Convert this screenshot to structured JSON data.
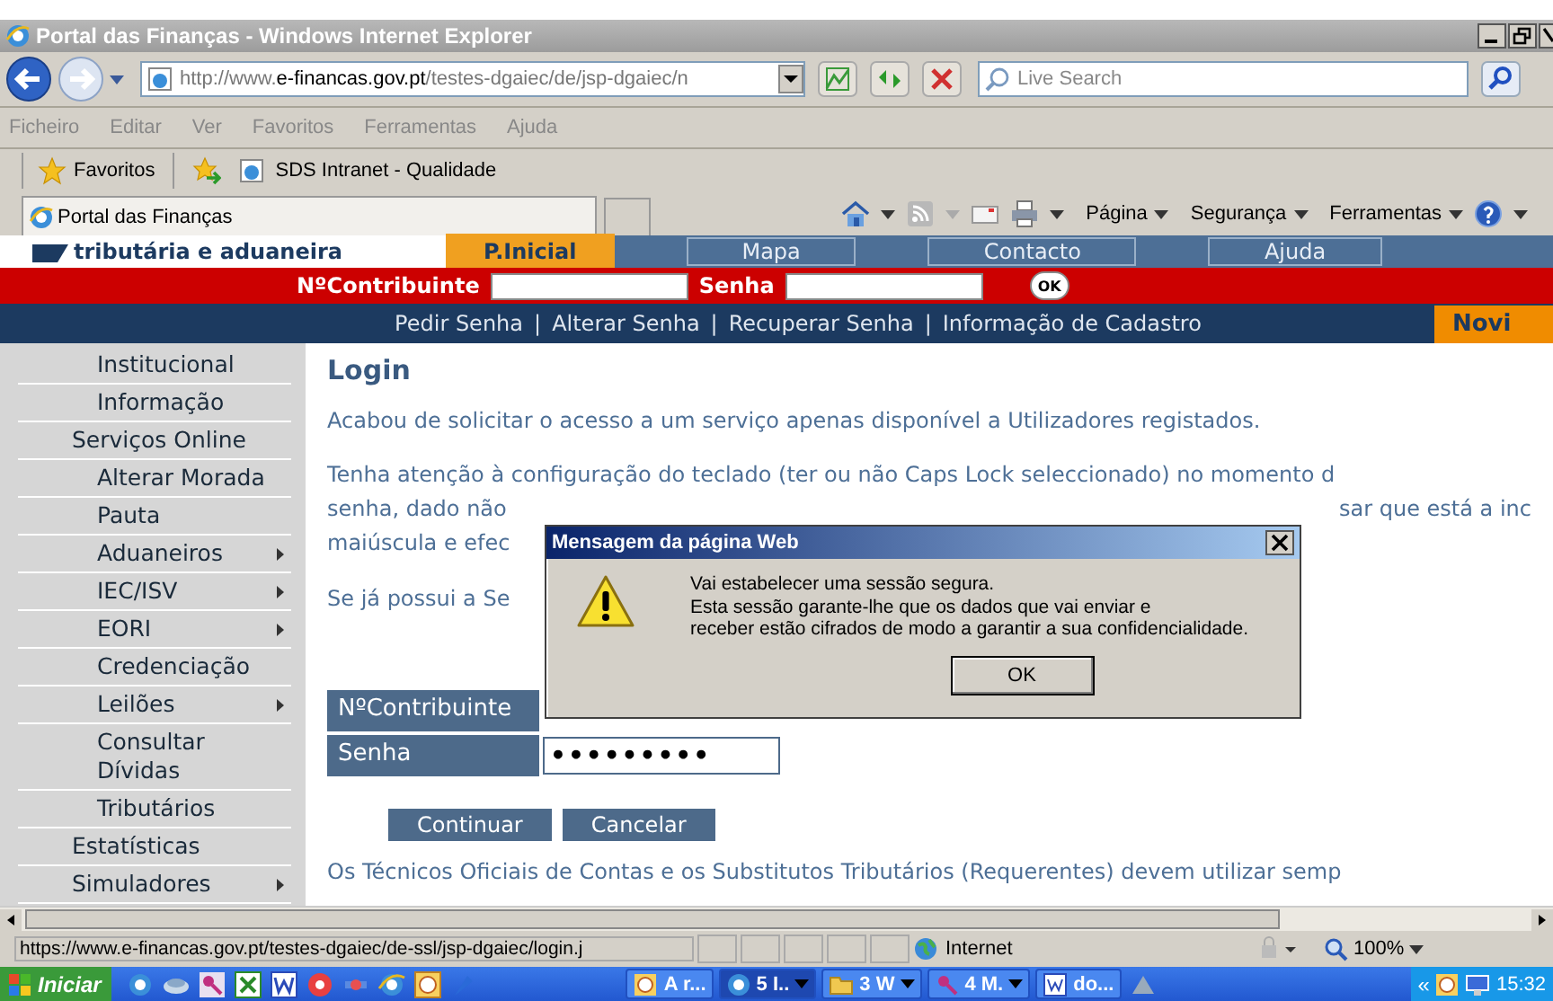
{
  "window": {
    "title": "Portal das Finanças - Windows Internet Explorer"
  },
  "address_bar": {
    "url": "http://www.**e-financas.gov.pt**/testes-dgaiec/de/jsp-dgaiec/n"
  },
  "search": {
    "placeholder": "Live Search"
  },
  "menu": [
    "Ficheiro",
    "Editar",
    "Ver",
    "Favoritos",
    "Ferramentas",
    "Ajuda"
  ],
  "favorites_bar": {
    "favorites": "Favoritos",
    "links": [
      "SDS Intranet -  Qualidade"
    ]
  },
  "tabs": [
    {
      "label": "Portal das Finanças",
      "selected": true
    }
  ],
  "command_bar": [
    "Página",
    "Segurança",
    "Ferramentas"
  ],
  "site_header": {
    "logo_text": "tributária e aduaneira",
    "nav": [
      {
        "label": "P.Inicial",
        "selected": true
      },
      {
        "label": "Mapa",
        "selected": false
      },
      {
        "label": "Contacto",
        "selected": false
      },
      {
        "label": "Ajuda",
        "selected": false
      }
    ]
  },
  "login_bar": {
    "contribuinte_label": "NºContribuinte",
    "senha_label": "Senha",
    "ok": "OK"
  },
  "link_bar": {
    "links": [
      "Pedir Senha",
      "Alterar Senha",
      "Recuperar Senha",
      "Informação de Cadastro"
    ],
    "separator": "|",
    "news_tab": "Novi"
  },
  "sidebar": [
    {
      "label": "Institucional",
      "kind": "item",
      "submenu": false
    },
    {
      "label": "Informação",
      "kind": "item",
      "submenu": false
    },
    {
      "label": "Serviços Online",
      "kind": "section",
      "submenu": false
    },
    {
      "label": "Alterar Morada",
      "kind": "item",
      "submenu": false
    },
    {
      "label": "Pauta",
      "kind": "item",
      "submenu": false
    },
    {
      "label": "Aduaneiros",
      "kind": "item",
      "submenu": true
    },
    {
      "label": "IEC/ISV",
      "kind": "item",
      "submenu": true
    },
    {
      "label": "EORI",
      "kind": "item",
      "submenu": true
    },
    {
      "label": "Credenciação",
      "kind": "item",
      "submenu": false
    },
    {
      "label": "Leilões",
      "kind": "item",
      "submenu": true
    },
    {
      "label": "Consultar Dívidas",
      "kind": "item",
      "submenu": false
    },
    {
      "label": "Tributários",
      "kind": "item",
      "submenu": false
    },
    {
      "label": "Estatísticas",
      "kind": "section",
      "submenu": false
    },
    {
      "label": "Simuladores",
      "kind": "section",
      "submenu": true
    }
  ],
  "content": {
    "title": "Login",
    "intro": "Acabou de solicitar o acesso a um serviço apenas disponível a Utilizadores registados.",
    "notice_lines": [
      {
        "left": "Tenha atenção à configuração do teclado (ter ou não Caps Lock seleccionado) no momento d"
      },
      {
        "left": "senha, dado não",
        "right": "sar que está a inc"
      },
      {
        "left": "maiúscula e efec"
      }
    ],
    "existing": "Se já possui a Se",
    "form": [
      {
        "label": "NºContribuinte"
      },
      {
        "label": "Senha",
        "value": "•••••••••"
      }
    ],
    "buttons": [
      "Continuar",
      "Cancelar"
    ],
    "footer_note": "Os Técnicos Oficiais de Contas e os Substitutos Tributários (Requerentes) devem utilizar semp"
  },
  "dialog": {
    "title": "Mensagem da página Web",
    "lines": [
      "Vai estabelecer uma sessão segura.",
      "Esta sessão garante-lhe que os dados que vai enviar e",
      "receber estão cifrados de modo a garantir a sua confidencialidade."
    ],
    "button": "OK"
  },
  "status_bar": {
    "url": "https://www.e-financas.gov.pt/testes-dgaiec/de-ssl/jsp-dgaiec/login.j",
    "zone": "Internet",
    "zoom": "100%"
  },
  "taskbar": {
    "start": "Iniciar",
    "tasks": [
      {
        "label": "A r...",
        "kind": "clock",
        "grouped": false,
        "selected": false
      },
      {
        "label": "5 I..",
        "kind": "browser",
        "grouped": true,
        "selected": true
      },
      {
        "label": "3 W",
        "kind": "folder",
        "grouped": true,
        "selected": false
      },
      {
        "label": "4 M.",
        "kind": "key",
        "grouped": true,
        "selected": false
      },
      {
        "label": "do...",
        "kind": "document",
        "grouped": false,
        "selected": false
      }
    ],
    "tray_chevron": "«",
    "clock": "15:32"
  }
}
